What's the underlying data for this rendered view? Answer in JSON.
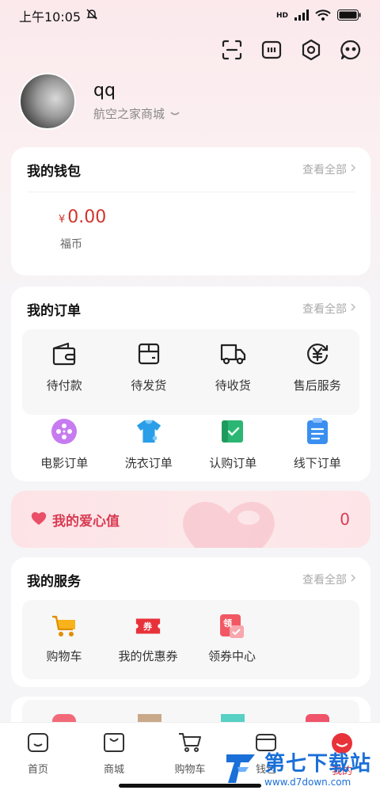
{
  "status": {
    "time": "上午10:05",
    "network": "HD"
  },
  "profile": {
    "name": "qq",
    "shop": "航空之家商城"
  },
  "wallet": {
    "title": "我的钱包",
    "view_all": "查看全部",
    "currency": "¥",
    "amount": "0.00",
    "label": "福币"
  },
  "orders": {
    "title": "我的订单",
    "view_all": "查看全部",
    "row1": [
      {
        "label": "待付款",
        "icon": "wallet-icon"
      },
      {
        "label": "待发货",
        "icon": "box-icon"
      },
      {
        "label": "待收货",
        "icon": "truck-icon"
      },
      {
        "label": "售后服务",
        "icon": "yen-refund-icon"
      }
    ],
    "row2": [
      {
        "label": "电影订单",
        "icon": "film-reel-icon",
        "color": "#c77bf0"
      },
      {
        "label": "洗衣订单",
        "icon": "tshirt-icon",
        "color": "#2a9ee8"
      },
      {
        "label": "认购订单",
        "icon": "scroll-check-icon",
        "color": "#2bb673"
      },
      {
        "label": "线下订单",
        "icon": "clipboard-icon",
        "color": "#3a8ef0"
      }
    ]
  },
  "love": {
    "title": "我的爱心值",
    "value": "0"
  },
  "services": {
    "title": "我的服务",
    "view_all": "查看全部",
    "items": [
      {
        "label": "购物车",
        "icon": "cart-icon"
      },
      {
        "label": "我的优惠券",
        "icon": "coupon-icon",
        "badge": "券"
      },
      {
        "label": "领券中心",
        "icon": "coupon-center-icon",
        "badge": "领"
      }
    ]
  },
  "tabs": [
    {
      "label": "首页",
      "icon": "home-icon"
    },
    {
      "label": "商城",
      "icon": "shop-bag-icon"
    },
    {
      "label": "购物车",
      "icon": "cart-icon"
    },
    {
      "label": "钱包",
      "icon": "wallet-icon"
    },
    {
      "label": "我的",
      "icon": "profile-face-icon"
    }
  ],
  "watermark": {
    "title": "第七下载站",
    "url": "www.d7down.com"
  },
  "colors": {
    "accent": "#d0342c",
    "love": "#d93b52",
    "watermark": "#1a6fd8"
  }
}
